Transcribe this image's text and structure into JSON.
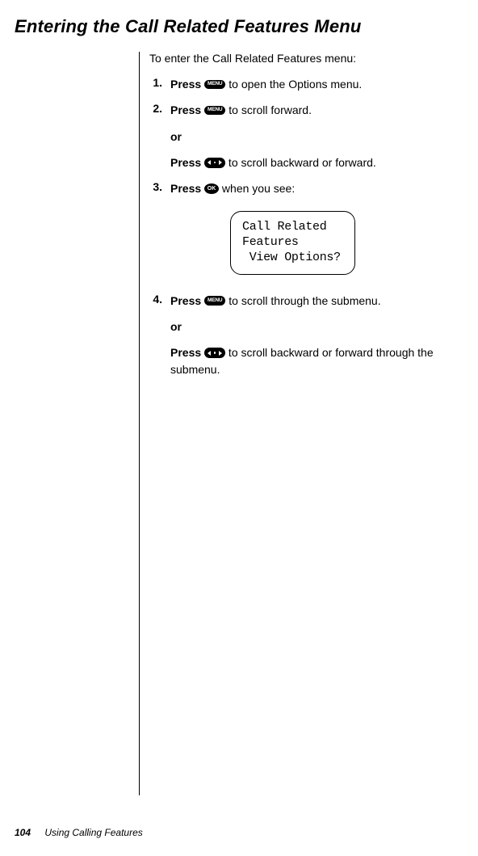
{
  "title": "Entering the Call Related Features Menu",
  "intro": "To enter the Call Related Features menu:",
  "steps": {
    "s1": {
      "num": "1.",
      "press": "Press",
      "icon_label": "MENU",
      "text_after": " to open the Options menu."
    },
    "s2": {
      "num": "2.",
      "press": "Press",
      "icon_label": "MENU",
      "text_after": " to scroll forward."
    },
    "s2_or": "or",
    "s2_alt": {
      "press": "Press",
      "text_after": " to scroll backward or forward."
    },
    "s3": {
      "num": "3.",
      "press": "Press",
      "icon_label": "OK",
      "text_after": " when you see:"
    },
    "s4": {
      "num": "4.",
      "press": "Press",
      "icon_label": "MENU",
      "text_after": " to scroll through the submenu."
    },
    "s4_or": "or",
    "s4_alt": {
      "press": "Press",
      "text_after": " to scroll backward or forward through the submenu."
    }
  },
  "lcd": {
    "line1": "Call Related",
    "line2": "Features",
    "line3": " View Options?"
  },
  "footer": {
    "page": "104",
    "section": "Using Calling Features"
  }
}
